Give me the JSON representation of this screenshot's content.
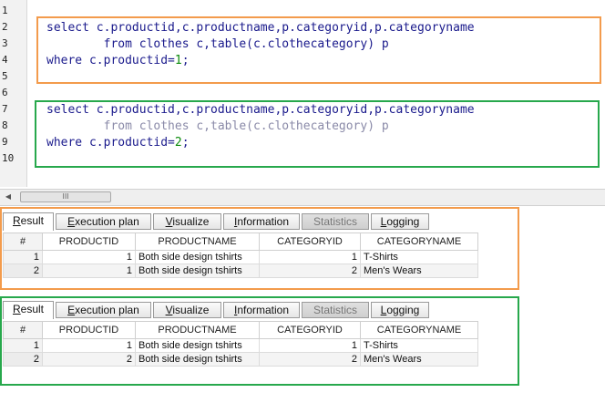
{
  "editor": {
    "line_numbers": [
      "1",
      "2",
      "3",
      "4",
      "5",
      "6",
      "7",
      "8",
      "9",
      "10"
    ],
    "query1": {
      "line1": "select c.productid,c.productname,p.categoryid,p.categoryname",
      "line2": "        from clothes c,table(c.clothecategory) p",
      "line3_prefix": "where c.productid=",
      "line3_value": "1",
      "line3_suffix": ";"
    },
    "query2": {
      "line1": "select c.productid,c.productname,p.categoryid,p.categoryname",
      "line2": "        from clothes c,table(c.clothecategory) p",
      "line3_prefix": "where c.productid=",
      "line3_value": "2",
      "line3_suffix": ";"
    },
    "highlight_colors": {
      "first": "#f39b4c",
      "second": "#27a84c"
    }
  },
  "scrollbar": {
    "thumb_grip": "III"
  },
  "panels": [
    {
      "tabs": [
        {
          "label_first": "R",
          "label_rest": "esult"
        },
        {
          "label_first": "E",
          "label_rest": "xecution plan"
        },
        {
          "label_first": "V",
          "label_rest": "isualize"
        },
        {
          "label_first": "I",
          "label_rest": "nformation"
        },
        {
          "label_first": "",
          "label_rest": "Statistics"
        },
        {
          "label_first": "L",
          "label_rest": "ogging"
        }
      ],
      "columns": [
        "#",
        "PRODUCTID",
        "PRODUCTNAME",
        "CATEGORYID",
        "CATEGORYNAME"
      ],
      "rows": [
        [
          "1",
          "1",
          "Both side design tshirts",
          "1",
          "T-Shirts"
        ],
        [
          "2",
          "1",
          "Both side design tshirts",
          "2",
          "Men's Wears"
        ]
      ]
    },
    {
      "tabs": [
        {
          "label_first": "R",
          "label_rest": "esult"
        },
        {
          "label_first": "E",
          "label_rest": "xecution plan"
        },
        {
          "label_first": "V",
          "label_rest": "isualize"
        },
        {
          "label_first": "I",
          "label_rest": "nformation"
        },
        {
          "label_first": "",
          "label_rest": "Statistics"
        },
        {
          "label_first": "L",
          "label_rest": "ogging"
        }
      ],
      "columns": [
        "#",
        "PRODUCTID",
        "PRODUCTNAME",
        "CATEGORYID",
        "CATEGORYNAME"
      ],
      "rows": [
        [
          "1",
          "1",
          "Both side design tshirts",
          "1",
          "T-Shirts"
        ],
        [
          "2",
          "2",
          "Both side design tshirts",
          "2",
          "Men's Wears"
        ]
      ]
    }
  ]
}
